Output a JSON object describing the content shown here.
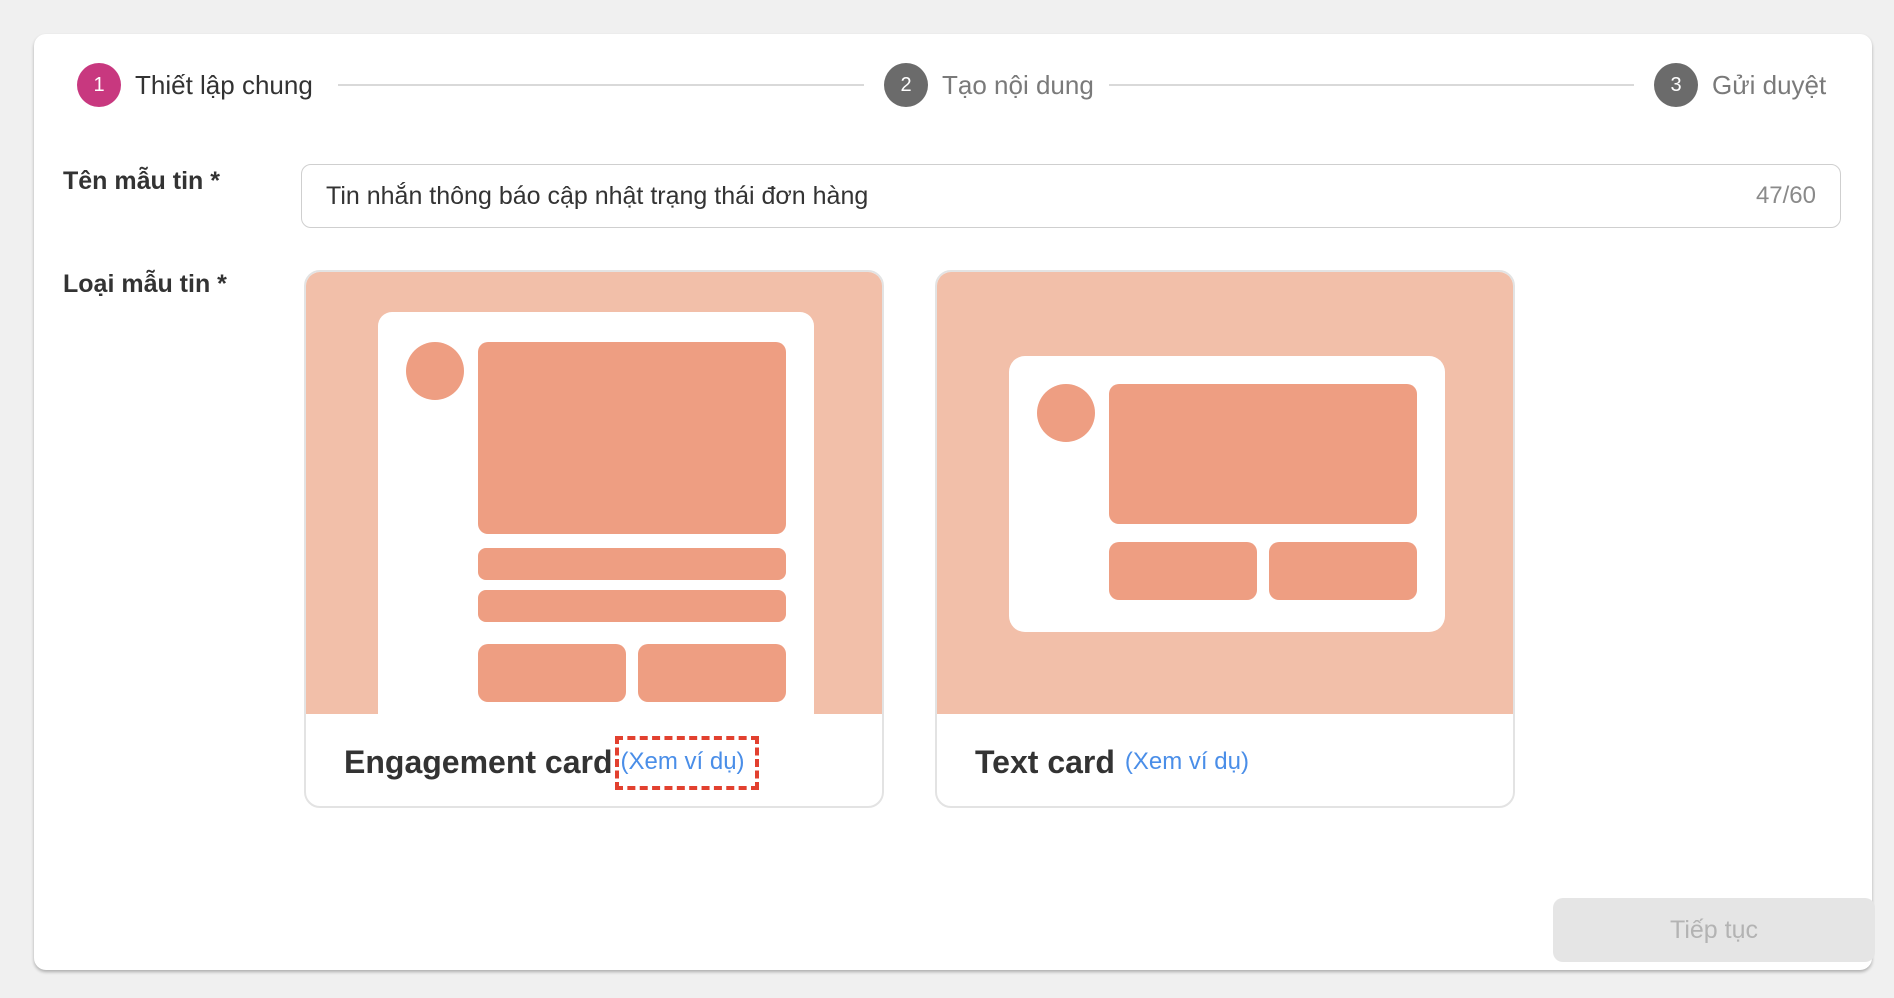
{
  "stepper": {
    "steps": [
      {
        "number": "1",
        "label": "Thiết lập chung",
        "state": "active"
      },
      {
        "number": "2",
        "label": "Tạo nội dung",
        "state": "inactive"
      },
      {
        "number": "3",
        "label": "Gửi duyệt",
        "state": "inactive"
      }
    ]
  },
  "form": {
    "name_label": "Tên mẫu tin *",
    "name_value": "Tin nhắn thông báo cập nhật trạng thái đơn hàng",
    "name_counter": "47/60",
    "type_label": "Loại mẫu tin *"
  },
  "cards": [
    {
      "title": "Engagement card",
      "link": "(Xem ví dụ)",
      "highlighted": true
    },
    {
      "title": "Text card",
      "link": "(Xem ví dụ)",
      "highlighted": false
    }
  ],
  "actions": {
    "continue_label": "Tiếp tục",
    "continue_disabled": true
  },
  "colors": {
    "active_step": "#c8387f",
    "inactive_step": "#6b6b6b",
    "card_art_bg": "#f2bfa9",
    "card_art_block": "#ee9e82",
    "link": "#4a8ee8",
    "highlight_dashed": "#e2402f"
  }
}
